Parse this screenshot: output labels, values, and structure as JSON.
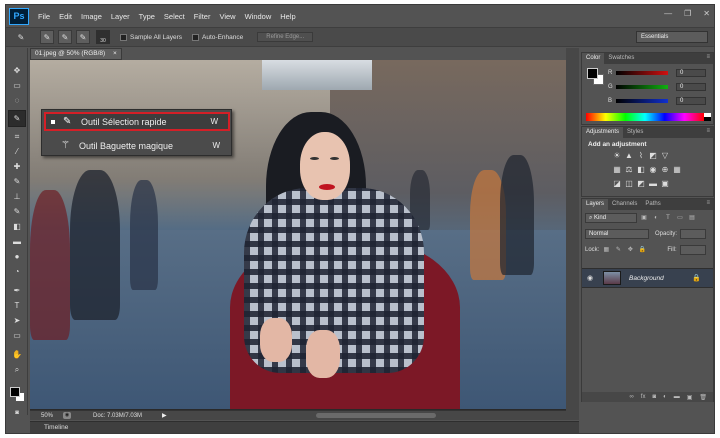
{
  "app": {
    "logo": "Ps"
  },
  "menubar": {
    "items": [
      "File",
      "Edit",
      "Image",
      "Layer",
      "Type",
      "Select",
      "Filter",
      "View",
      "Window",
      "Help"
    ],
    "window_controls": [
      "—",
      "❐",
      "✕"
    ]
  },
  "optionsbar": {
    "brush_size": "30",
    "sample_all_layers": "Sample All Layers",
    "auto_enhance": "Auto-Enhance",
    "refine_edge": "Refine Edge...",
    "workspace": "Essentials"
  },
  "document": {
    "tab_title": "01.jpeg @ 50% (RGB/8)",
    "tab_close": "×",
    "zoom": "50%",
    "doc_info": "Doc: 7.03M/7.03M",
    "timeline": "Timeline"
  },
  "flyout": {
    "items": [
      {
        "label": "Outil Sélection rapide",
        "shortcut": "W",
        "icon": "quick-selection-brush-icon"
      },
      {
        "label": "Outil Baguette magique",
        "shortcut": "W",
        "icon": "magic-wand-icon"
      }
    ]
  },
  "color_panel": {
    "tabs": [
      "Color",
      "Swatches"
    ],
    "channels": [
      {
        "label": "R",
        "value": "0",
        "color": "#d01010"
      },
      {
        "label": "G",
        "value": "0",
        "color": "#10b010"
      },
      {
        "label": "B",
        "value": "0",
        "color": "#1030d0"
      }
    ]
  },
  "adjustments_panel": {
    "tabs": [
      "Adjustments",
      "Styles"
    ],
    "title": "Add an adjustment"
  },
  "layers_panel": {
    "tabs": [
      "Layers",
      "Channels",
      "Paths"
    ],
    "kind": "Kind",
    "blend_mode": "Normal",
    "opacity_label": "Opacity:",
    "lock_label": "Lock:",
    "fill_label": "Fill:",
    "layer_name": "Background"
  },
  "colors": {
    "flyout_highlight": "#d41f27",
    "panel_bg": "#535353",
    "dark_bg": "#2a2a2a"
  }
}
